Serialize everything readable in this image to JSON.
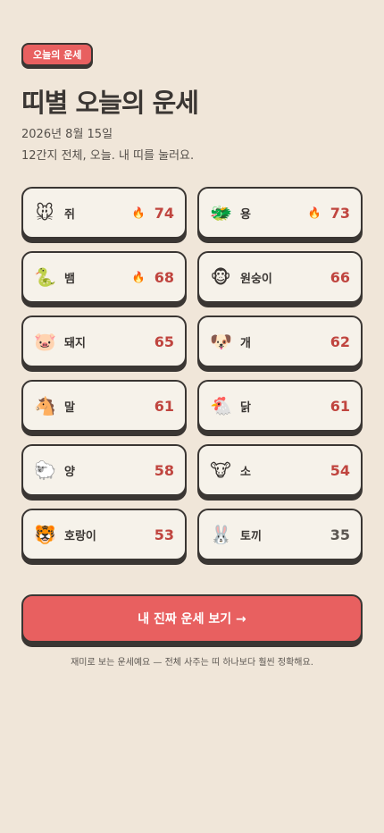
{
  "badge": "오늘의 운세",
  "title": "띠별 오늘의 운세",
  "date": "2026년 8월 15일",
  "subtitle": "12간지 전체, 오늘. 내 띠를 눌러요.",
  "animals": [
    {
      "emoji": "🐭",
      "icon": "rat-icon",
      "name": "쥐",
      "score": "74",
      "hot": true
    },
    {
      "emoji": "🐲",
      "icon": "dragon-icon",
      "name": "용",
      "score": "73",
      "hot": true
    },
    {
      "emoji": "🐍",
      "icon": "snake-icon",
      "name": "뱀",
      "score": "68",
      "hot": true
    },
    {
      "emoji": "🐵",
      "icon": "monkey-icon",
      "name": "원숭이",
      "score": "66",
      "hot": false
    },
    {
      "emoji": "🐷",
      "icon": "pig-icon",
      "name": "돼지",
      "score": "65",
      "hot": false
    },
    {
      "emoji": "🐶",
      "icon": "dog-icon",
      "name": "개",
      "score": "62",
      "hot": false
    },
    {
      "emoji": "🐴",
      "icon": "horse-icon",
      "name": "말",
      "score": "61",
      "hot": false
    },
    {
      "emoji": "🐔",
      "icon": "rooster-icon",
      "name": "닭",
      "score": "61",
      "hot": false
    },
    {
      "emoji": "🐑",
      "icon": "sheep-icon",
      "name": "양",
      "score": "58",
      "hot": false
    },
    {
      "emoji": "🐮",
      "icon": "ox-icon",
      "name": "소",
      "score": "54",
      "hot": false
    },
    {
      "emoji": "🐯",
      "icon": "tiger-icon",
      "name": "호랑이",
      "score": "53",
      "hot": false
    },
    {
      "emoji": "🐰",
      "icon": "rabbit-icon",
      "name": "토끼",
      "score": "35",
      "hot": false
    }
  ],
  "fire_emoji": "🔥",
  "cta_label": "내 진짜 운세 보기 →",
  "footer": "재미로 보는 운세예요 — 전체 사주는 띠 하나보다 훨씬 정확해요.",
  "colors": {
    "accent": "#e86060",
    "score": "#c0453f",
    "background": "#f0e6d9",
    "card": "#f6f2ea",
    "border": "#3a3633"
  }
}
